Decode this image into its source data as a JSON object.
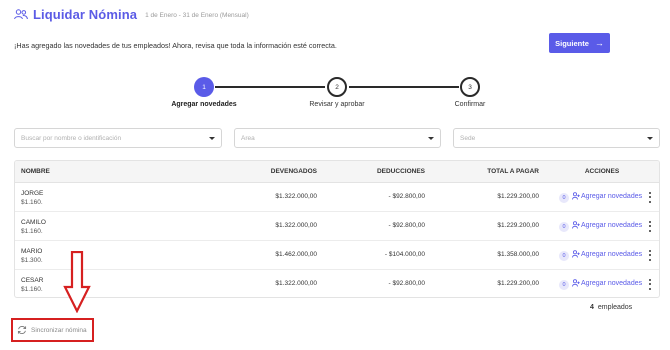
{
  "header": {
    "icon": "users-icon",
    "title": "Liquidar Nómina",
    "period": "1 de Enero  -  31 de Enero (Mensual)"
  },
  "notice": "¡Has agregado las novedades de tus empleados! Ahora, revisa que toda la información esté correcta.",
  "next_button": {
    "label": "Siguiente",
    "icon": "arrow-right-icon",
    "color": "#5a5be8"
  },
  "stepper": {
    "steps": [
      {
        "number": "1",
        "label": "Agregar novedades",
        "active": true
      },
      {
        "number": "2",
        "label": "Revisar y aprobar",
        "active": false
      },
      {
        "number": "3",
        "label": "Confirmar",
        "active": false
      }
    ]
  },
  "filters": {
    "search": {
      "placeholder": "Buscar por nombre o identificación",
      "value": ""
    },
    "area": {
      "placeholder": "Área",
      "value": ""
    },
    "sede": {
      "placeholder": "Sede",
      "value": ""
    }
  },
  "table": {
    "columns": [
      "NOMBRE",
      "DEVENGADOS",
      "DEDUCCIONES",
      "TOTAL A PAGAR",
      "ACCIONES"
    ],
    "rows": [
      {
        "name": "JORGE",
        "salary": "$1.160.",
        "devengados": "$1.322.000,00",
        "deducciones": "- $92.800,00",
        "total": "$1.229.200,00",
        "badge": "0",
        "action": "Agregar novedades"
      },
      {
        "name": "CAMILO",
        "salary": "$1.160.",
        "devengados": "$1.322.000,00",
        "deducciones": "- $92.800,00",
        "total": "$1.229.200,00",
        "badge": "0",
        "action": "Agregar novedades"
      },
      {
        "name": "MARIO",
        "salary": "$1.300.",
        "devengados": "$1.462.000,00",
        "deducciones": "- $104.000,00",
        "total": "$1.358.000,00",
        "badge": "0",
        "action": "Agregar novedades"
      },
      {
        "name": "CESAR",
        "salary": "$1.160.",
        "devengados": "$1.322.000,00",
        "deducciones": "- $92.800,00",
        "total": "$1.229.200,00",
        "badge": "0",
        "action": "Agregar novedades"
      }
    ]
  },
  "employee_count": {
    "number": "4",
    "label": "empleados"
  },
  "sync_button": {
    "label": "Sincronizar nómina",
    "icon": "sync-icon"
  },
  "colors": {
    "accent": "#5a5be8",
    "annotation": "#d62020"
  }
}
